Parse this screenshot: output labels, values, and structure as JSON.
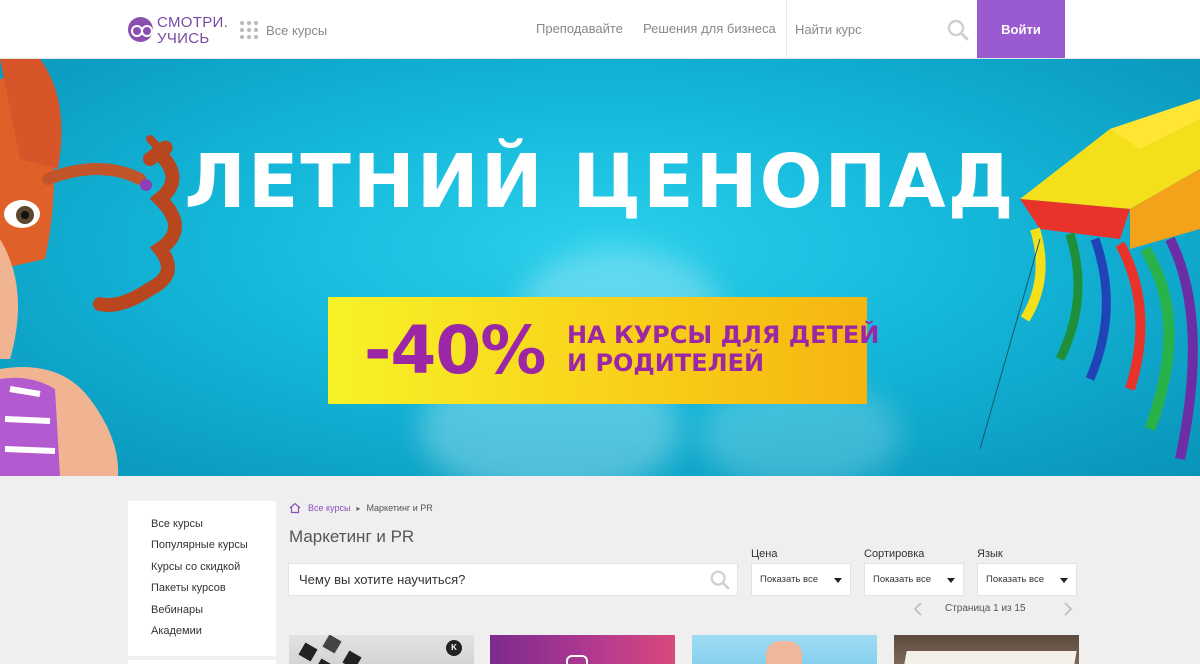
{
  "header": {
    "logo_line1": "СМОТРИ.",
    "logo_line2": "УЧИСЬ",
    "all_courses": "Все курсы",
    "nav_teach": "Преподавайте",
    "nav_business": "Решения для бизнеса",
    "search_placeholder": "Найти курс",
    "login": "Войти"
  },
  "hero": {
    "title": "ЛЕТНИЙ ЦЕНОПАД",
    "discount": "-40%",
    "promo_line1": "НА КУРСЫ ДЛЯ ДЕТЕЙ",
    "promo_line2": "И РОДИТЕЛЕЙ"
  },
  "sidebar": {
    "items": [
      {
        "label": "Все курсы"
      },
      {
        "label": "Популярные курсы"
      },
      {
        "label": "Курсы со скидкой"
      },
      {
        "label": "Пакеты курсов"
      },
      {
        "label": "Вебинары"
      },
      {
        "label": "Академии"
      }
    ]
  },
  "breadcrumb": {
    "home": "Все курсы",
    "current": "Маркетинг и PR"
  },
  "main": {
    "title": "Маркетинг и PR",
    "search_placeholder": "Чему вы хотите научиться?"
  },
  "filters": {
    "price_label": "Цена",
    "price_value": "Показать все",
    "sort_label": "Сортировка",
    "sort_value": "Показать все",
    "lang_label": "Язык",
    "lang_value": "Показать все"
  },
  "pagination": {
    "text": "Страница 1 из 15"
  },
  "cards": {
    "card1_logo": "K"
  },
  "colors": {
    "brand_purple": "#9b5bd0",
    "hero_sky": "#14b7d9",
    "promo_yellow": "#f9d01a",
    "promo_text": "#9b27a6"
  },
  "icons": {
    "search": "search-icon",
    "grid": "grid-icon",
    "home": "home-icon",
    "dropdown": "chevron-down-icon",
    "prev": "chevron-left-icon",
    "next": "chevron-right-icon"
  }
}
